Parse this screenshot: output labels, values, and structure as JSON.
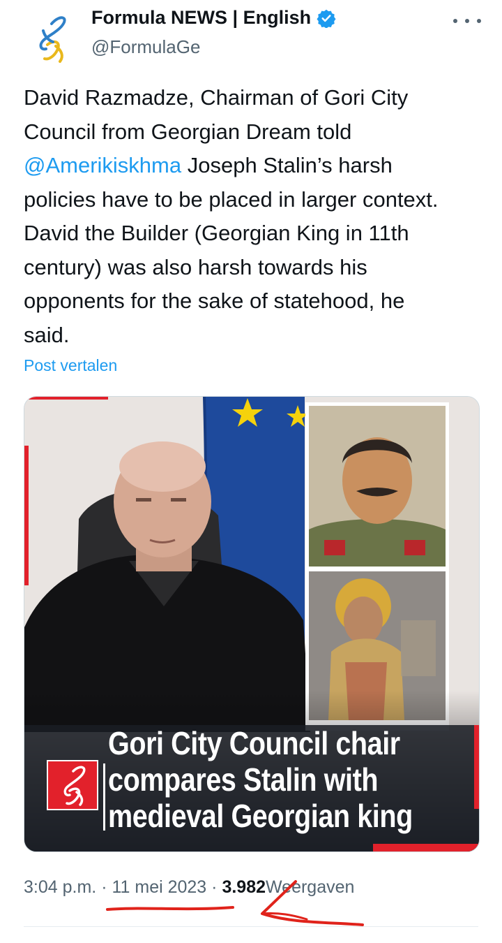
{
  "header": {
    "display_name": "Formula NEWS | English",
    "handle": "@FormulaGe",
    "avatar_icon": "formula-logo-icon",
    "verified_icon": "verified-badge-icon",
    "more_icon": "more-options-icon"
  },
  "tweet": {
    "lines": [
      {
        "before": "David Razmadze, Chairman of Gori City",
        "mention": "",
        "after": ""
      },
      {
        "before": "Council from Georgian Dream told",
        "mention": "",
        "after": ""
      },
      {
        "before": "",
        "mention": "@Amerikiskhma",
        "after": " Joseph Stalin’s harsh"
      },
      {
        "before": "policies have to be placed in larger context.",
        "mention": "",
        "after": ""
      },
      {
        "before": "David the Builder (Georgian King in 11th",
        "mention": "",
        "after": ""
      },
      {
        "before": "century) was also harsh towards his",
        "mention": "",
        "after": ""
      },
      {
        "before": "opponents for the sake of statehood, he",
        "mention": "",
        "after": ""
      },
      {
        "before": "said.",
        "mention": "",
        "after": ""
      }
    ],
    "translate_label": "Post vertalen"
  },
  "media": {
    "headline_lines": [
      "Gori City Council chair",
      "compares Stalin with",
      "medieval Georgian king"
    ],
    "logo_icon": "formula-logo-icon"
  },
  "meta": {
    "time": "3:04 p.m.",
    "separator": "·",
    "date": "11 mei 2023",
    "views_count": "3.982",
    "views_label": "Weergaven"
  },
  "colors": {
    "link": "#1d9bf0",
    "secondary_text": "#536471",
    "brand_red": "#e2212b",
    "annotation_red": "#e0231b"
  }
}
